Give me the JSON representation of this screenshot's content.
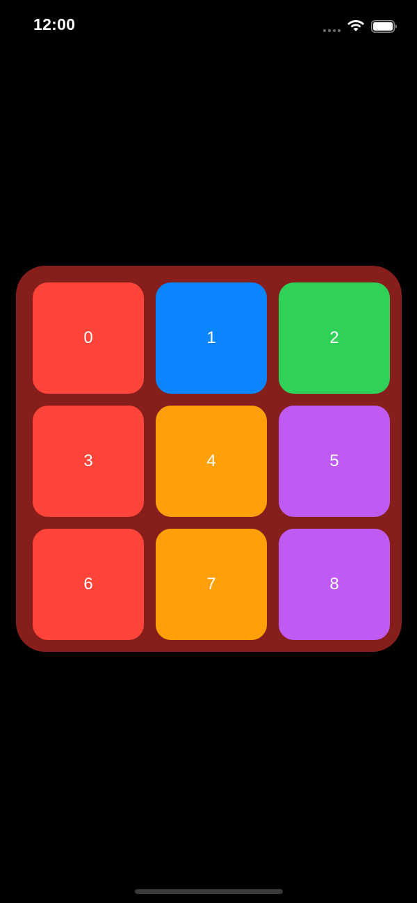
{
  "status_bar": {
    "time": "12:00",
    "icons": [
      "signal-dots-icon",
      "wifi-icon",
      "battery-icon"
    ]
  },
  "colors": {
    "background": "#000000",
    "board": "#861f1c",
    "red": "#ff453a",
    "blue": "#0a84ff",
    "green": "#30d158",
    "orange": "#ff9f0a",
    "purple": "#bf5af2"
  },
  "grid": {
    "rows": 3,
    "columns": 3,
    "tiles": [
      {
        "label": "0",
        "color": "#ff453a"
      },
      {
        "label": "1",
        "color": "#0a84ff"
      },
      {
        "label": "2",
        "color": "#30d158"
      },
      {
        "label": "3",
        "color": "#ff453a"
      },
      {
        "label": "4",
        "color": "#ff9f0a"
      },
      {
        "label": "5",
        "color": "#bf5af2"
      },
      {
        "label": "6",
        "color": "#ff453a"
      },
      {
        "label": "7",
        "color": "#ff9f0a"
      },
      {
        "label": "8",
        "color": "#bf5af2"
      }
    ]
  }
}
